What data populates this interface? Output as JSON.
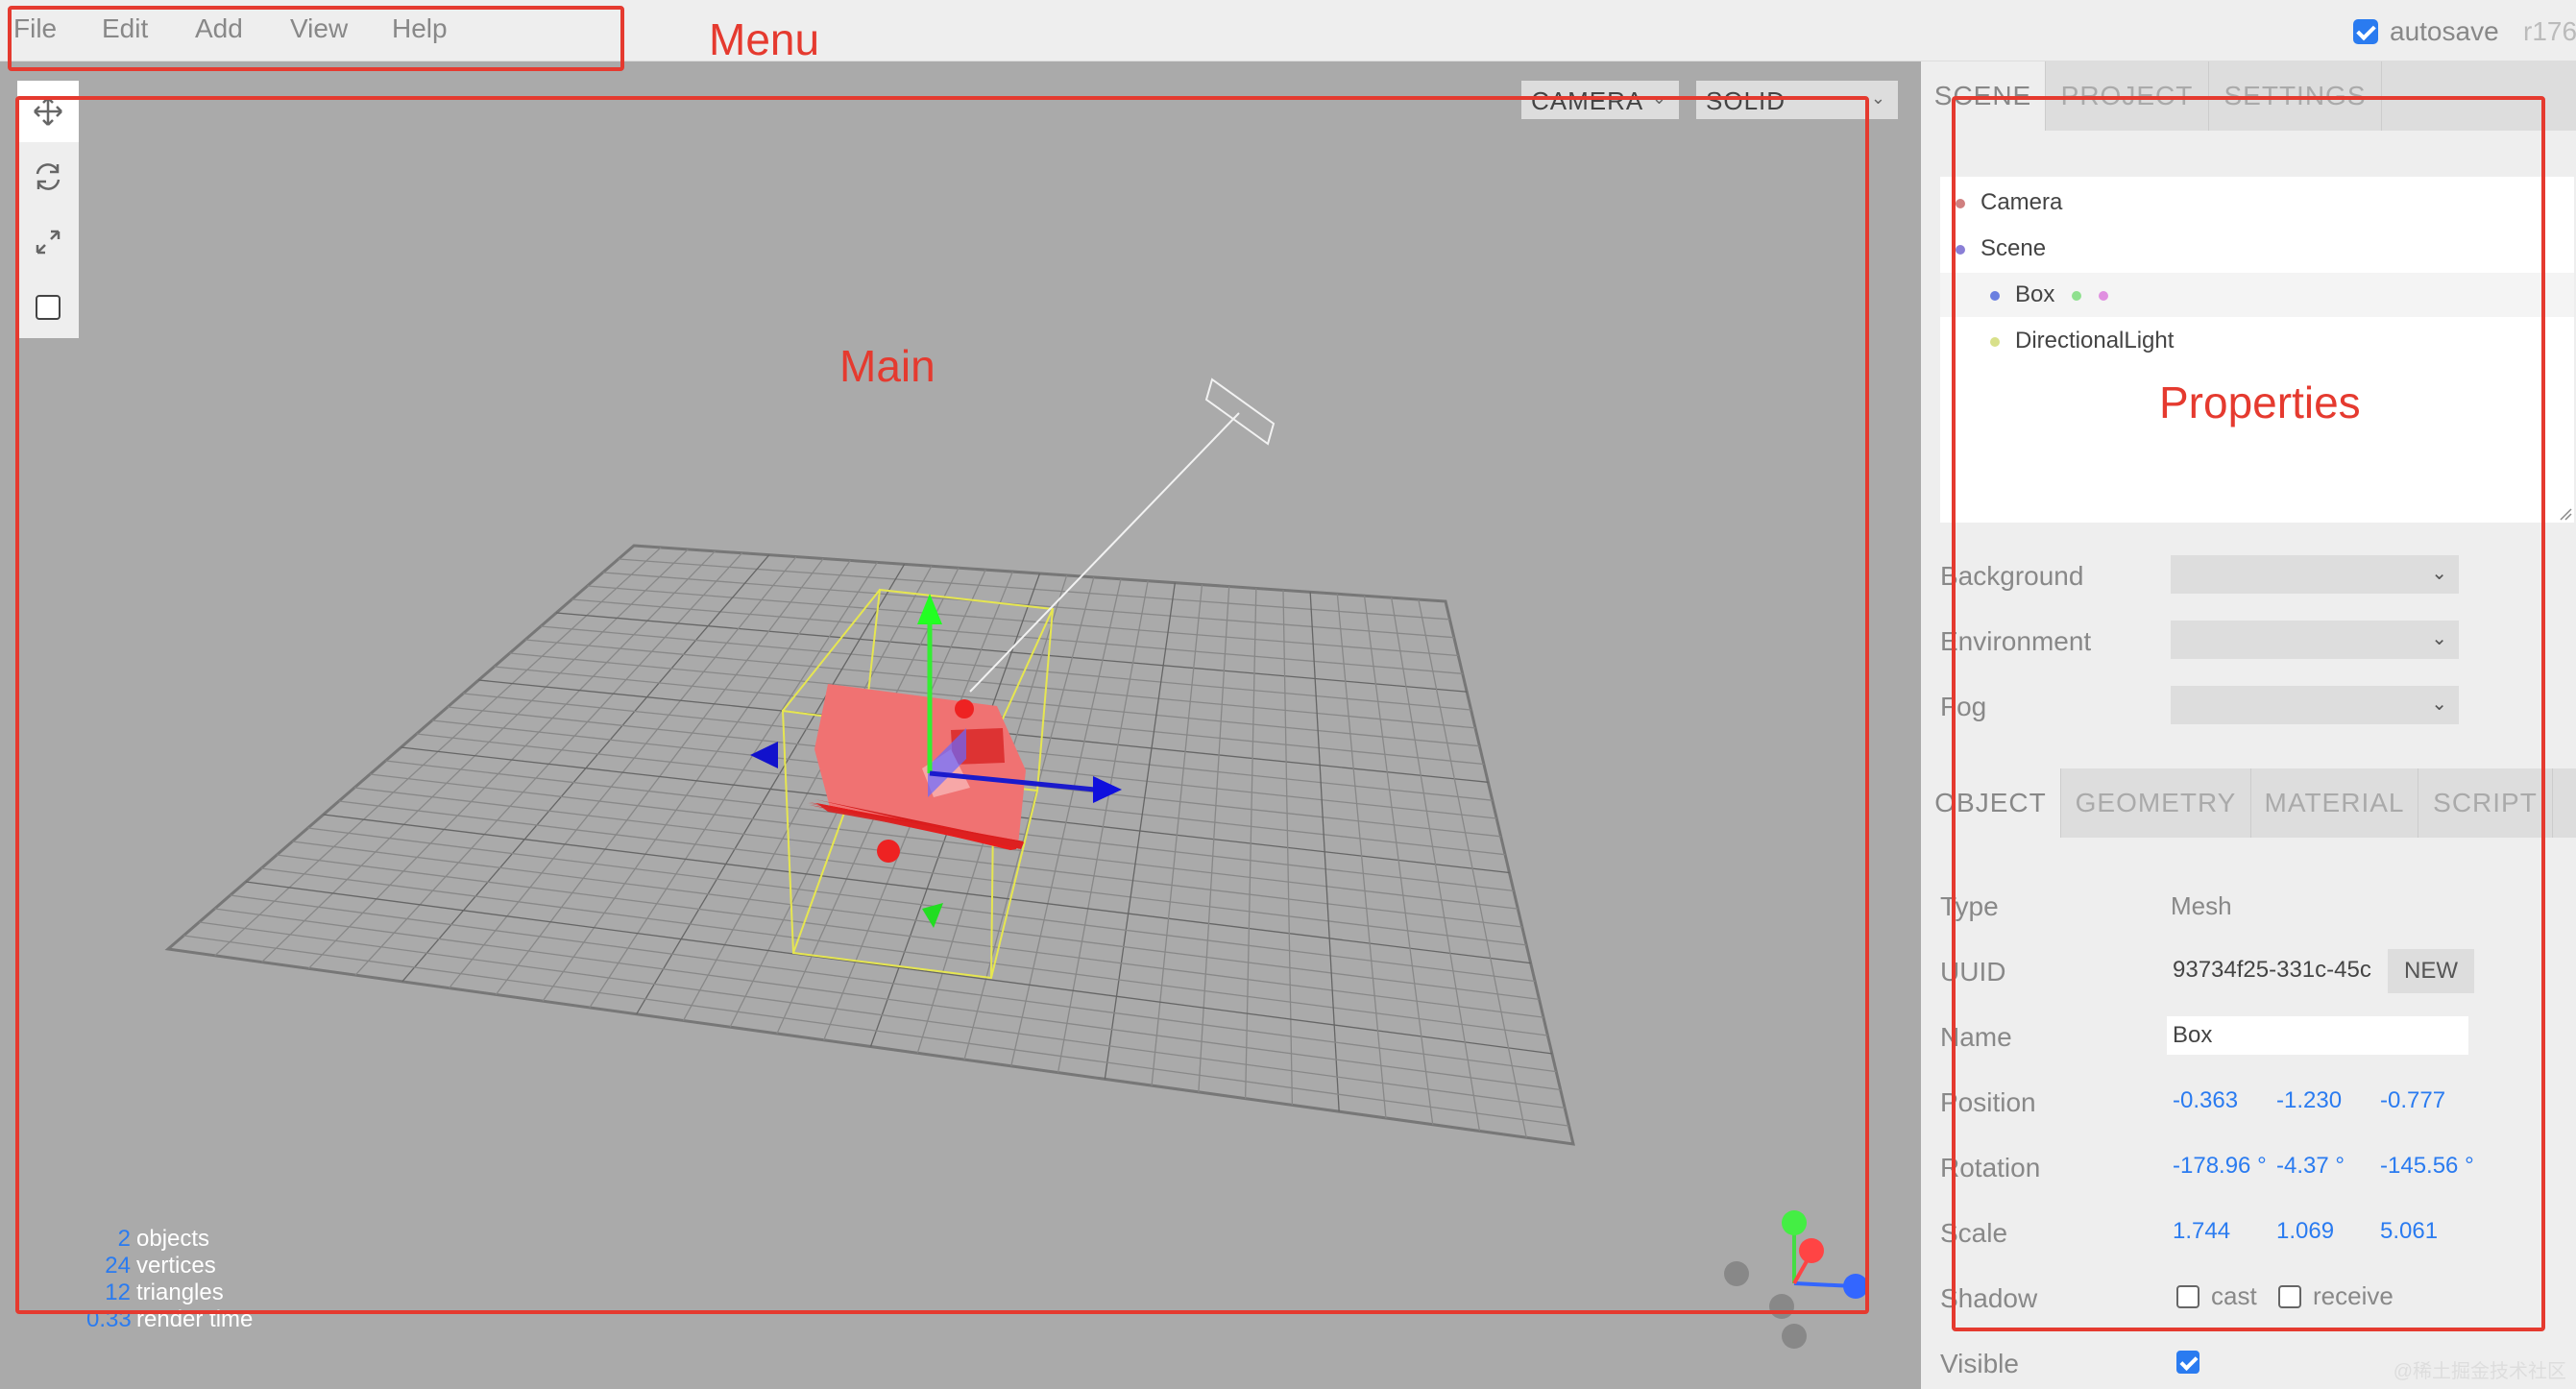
{
  "menubar": {
    "items": [
      "File",
      "Edit",
      "Add",
      "View",
      "Help"
    ],
    "autosave_label": "autosave",
    "autosave_checked": true,
    "revision": "r176"
  },
  "viewport": {
    "camera_select": "CAMERA",
    "shading_select": "SOLID",
    "toolbar": [
      "translate-icon",
      "rotate-icon",
      "scale-icon",
      "local-space-icon"
    ],
    "info": [
      {
        "value": "2",
        "label": "objects"
      },
      {
        "value": "24",
        "label": "vertices"
      },
      {
        "value": "12",
        "label": "triangles"
      },
      {
        "value": "0.33",
        "label": "render time"
      }
    ]
  },
  "sidebar": {
    "top_tabs": [
      "SCENE",
      "PROJECT",
      "SETTINGS"
    ],
    "outliner": [
      {
        "label": "Camera",
        "dot": "#d08080",
        "indent": 0
      },
      {
        "label": "Scene",
        "dot": "#8a7fd6",
        "indent": 0
      },
      {
        "label": "Box",
        "dot": "#6a7fe0",
        "indent": 1,
        "selected": true,
        "extra_dots": [
          "#8fe08f",
          "#e08fe0"
        ]
      },
      {
        "label": "DirectionalLight",
        "dot": "#d8e08a",
        "indent": 1
      }
    ],
    "scene_props": {
      "background_label": "Background",
      "environment_label": "Environment",
      "fog_label": "Fog"
    },
    "object_tabs": [
      "OBJECT",
      "GEOMETRY",
      "MATERIAL",
      "SCRIPT"
    ],
    "object": {
      "type_label": "Type",
      "type_value": "Mesh",
      "uuid_label": "UUID",
      "uuid_value": "93734f25-331c-45c",
      "uuid_button": "NEW",
      "name_label": "Name",
      "name_value": "Box",
      "position_label": "Position",
      "position": [
        "-0.363",
        "-1.230",
        "-0.777"
      ],
      "rotation_label": "Rotation",
      "rotation": [
        "-178.96 °",
        "-4.37 °",
        "-145.56 °"
      ],
      "scale_label": "Scale",
      "scale": [
        "1.744",
        "1.069",
        "5.061"
      ],
      "shadow_label": "Shadow",
      "cast_label": "cast",
      "receive_label": "receive",
      "visible_label": "Visible",
      "visible_checked": true
    }
  },
  "annotations": {
    "menu": "Menu",
    "main": "Main",
    "properties": "Properties"
  },
  "watermark": "@稀土掘金技术社区",
  "colors": {
    "accent": "#2a7bf0",
    "annotation": "#e53a2f",
    "viewport_bg": "#aaaaaa",
    "panel_bg": "#eeeeee"
  }
}
